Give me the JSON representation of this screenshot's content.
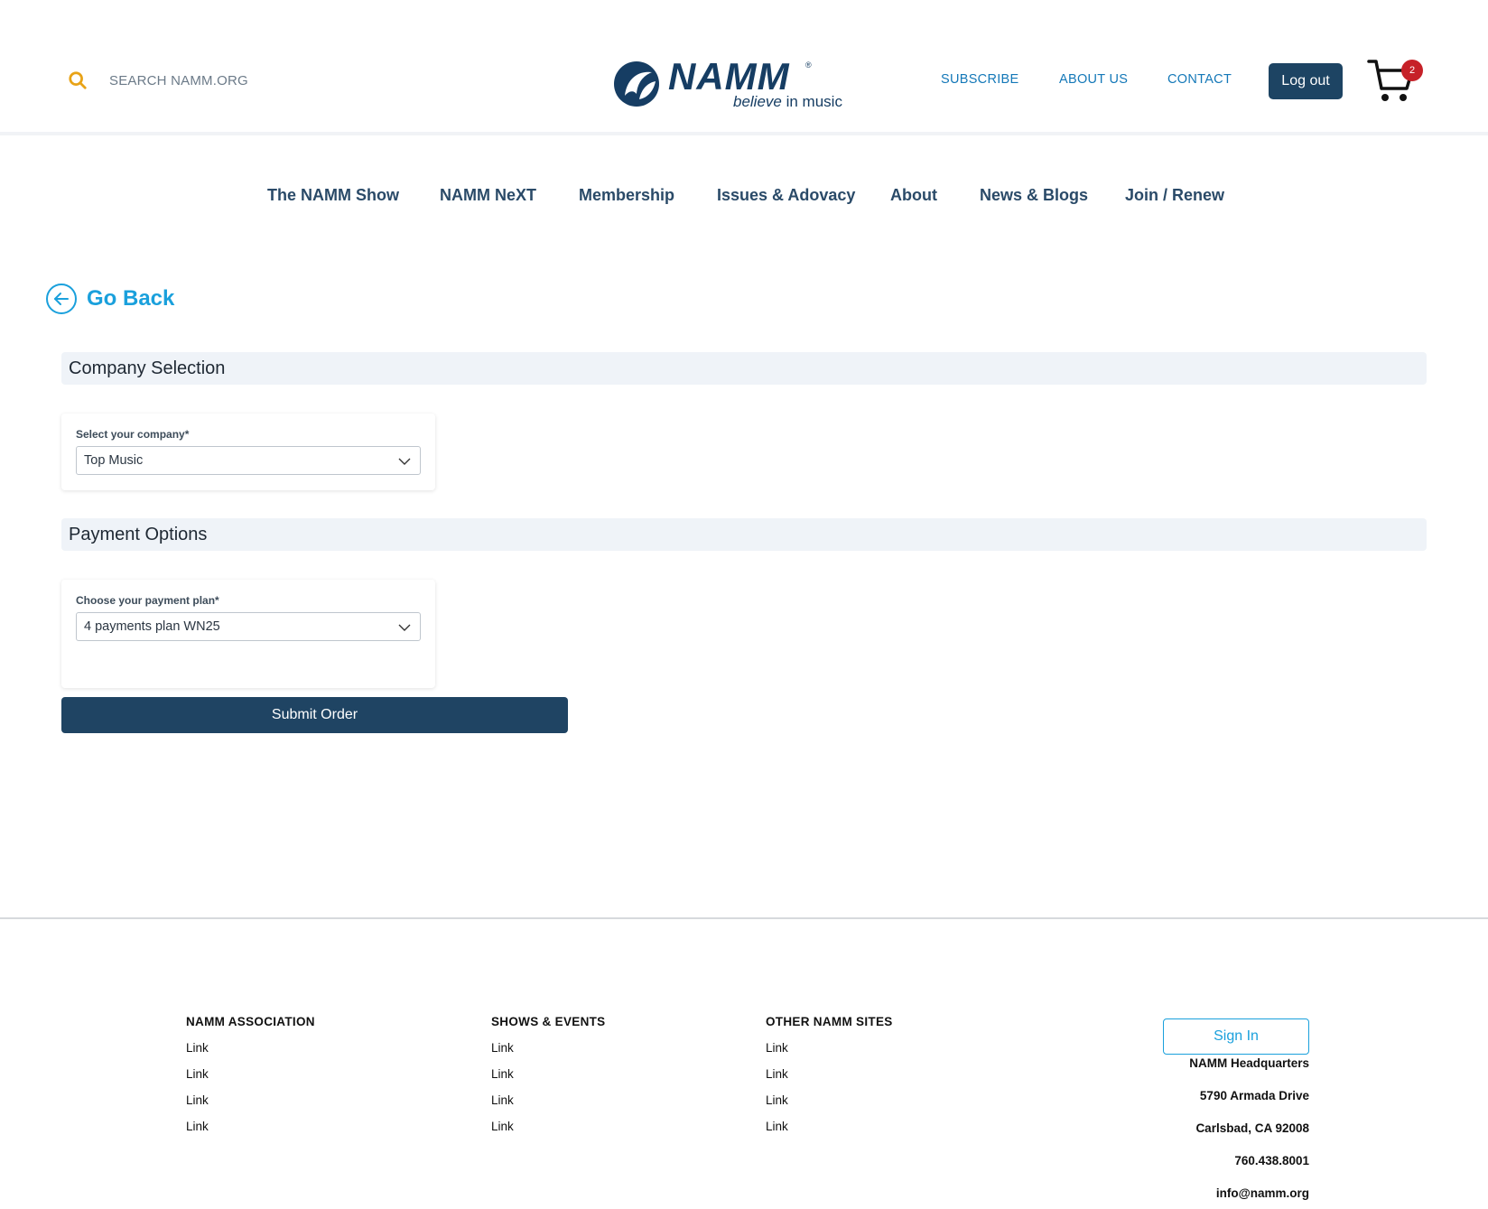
{
  "header": {
    "search_placeholder": "SEARCH NAMM.ORG",
    "logo_word": "NAMM",
    "logo_reg": "®",
    "logo_tag_italic": "believe",
    "logo_tag_rest": " in music",
    "links": [
      "SUBSCRIBE",
      "ABOUT US",
      "CONTACT"
    ],
    "logout_label": "Log out",
    "cart_count": "2"
  },
  "nav": {
    "items": [
      "The NAMM Show",
      "NAMM NeXT",
      "Membership",
      "Issues & Adovacy",
      "About",
      "News & Blogs",
      "Join / Renew"
    ]
  },
  "go_back_label": "Go Back",
  "company_section": {
    "title": "Company Selection",
    "label": "Select your company*",
    "value": "Top Music"
  },
  "payment_section": {
    "title": "Payment Options",
    "label": "Choose your payment plan*",
    "value": "4 payments plan WN25"
  },
  "submit_label": "Submit Order",
  "footer": {
    "columns": [
      {
        "heading": "NAMM ASSOCIATION",
        "links": [
          "Link",
          "Link",
          "Link",
          "Link"
        ]
      },
      {
        "heading": "SHOWS & EVENTS",
        "links": [
          "Link",
          "Link",
          "Link",
          "Link"
        ]
      },
      {
        "heading": "OTHER NAMM SITES",
        "links": [
          "Link",
          "Link",
          "Link",
          "Link"
        ]
      }
    ],
    "signin_label": "Sign In",
    "address": [
      "NAMM Headquarters",
      "5790 Armada Drive",
      "Carlsbad, CA 92008",
      "760.438.8001",
      "info@namm.org"
    ]
  },
  "colors": {
    "brand_navy": "#163d63",
    "button_navy": "#1f4463",
    "link_blue": "#1478b8",
    "accent_cyan": "#1aa0dc",
    "search_icon": "#e8a317",
    "badge_red": "#c62128"
  }
}
